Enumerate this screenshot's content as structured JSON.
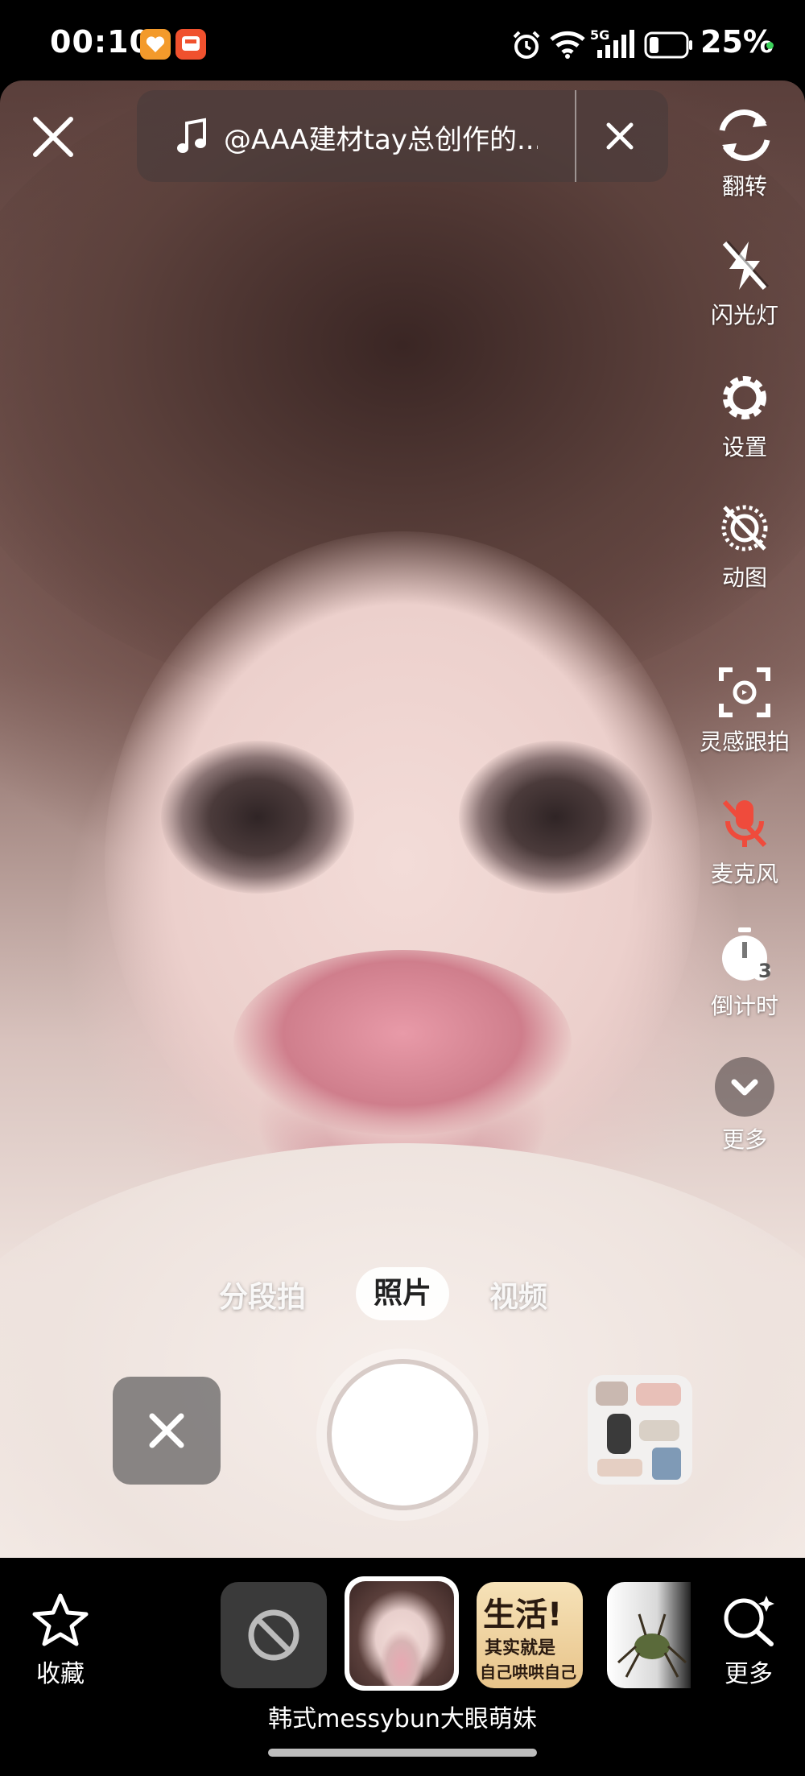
{
  "status_bar": {
    "time": "00:10",
    "network": "5G",
    "battery": "25%"
  },
  "camera": {
    "music_text": "@AAA建材tay总创作的...",
    "tools": [
      {
        "label": "翻转",
        "icon": "flip-camera-icon"
      },
      {
        "label": "闪光灯",
        "icon": "flash-off-icon"
      },
      {
        "label": "设置",
        "icon": "settings-gear-icon"
      },
      {
        "label": "动图",
        "icon": "live-photo-off-icon"
      },
      {
        "label": "灵感跟拍",
        "icon": "inspiration-follow-icon"
      },
      {
        "label": "麦克风",
        "icon": "microphone-off-icon"
      },
      {
        "label": "倒计时",
        "icon": "countdown-timer-icon",
        "badge": "3"
      },
      {
        "label": "更多",
        "icon": "chevron-down-icon"
      }
    ],
    "modes": [
      "分段拍",
      "照片",
      "视频"
    ],
    "active_mode": "照片",
    "accent_mic_color": "#ef4b3c"
  },
  "bottom": {
    "favorite_label": "收藏",
    "more_label": "更多",
    "effect_name": "韩式messybun大眼萌妹",
    "effect_thumb_text": [
      "生活!",
      "其实就是",
      "自己哄哄自己"
    ]
  }
}
